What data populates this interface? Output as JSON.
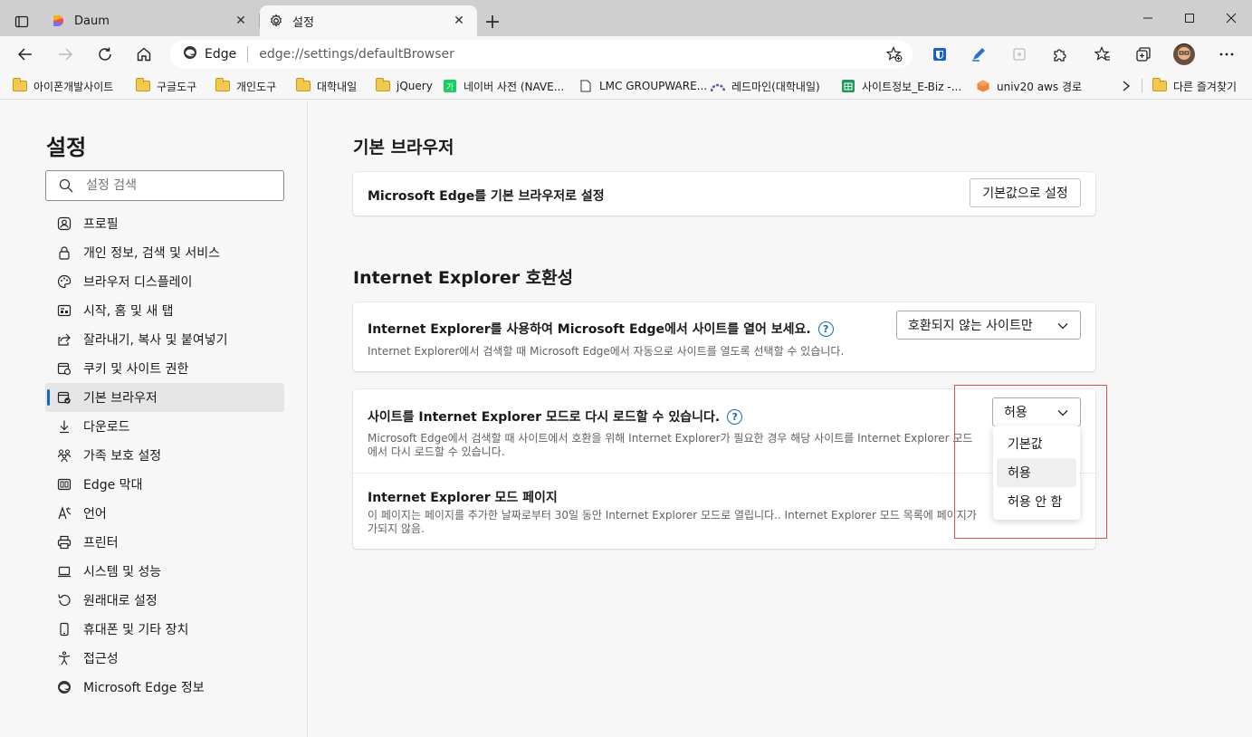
{
  "tabs": [
    {
      "title": "Daum",
      "icon": "daum-logo-icon"
    },
    {
      "title": "설정",
      "icon": "gear-icon"
    }
  ],
  "address": {
    "edge_label": "Edge",
    "url": "edge://settings/defaultBrowser"
  },
  "bookmarks": [
    {
      "label": "아이폰개발사이트",
      "icon": "folder-icon"
    },
    {
      "label": "구글도구",
      "icon": "folder-icon"
    },
    {
      "label": "개인도구",
      "icon": "folder-icon"
    },
    {
      "label": "대학내일",
      "icon": "folder-icon"
    },
    {
      "label": "jQuery",
      "icon": "folder-icon"
    },
    {
      "label": "네이버 사전 (NAVE...",
      "icon": "naver-dict-icon"
    },
    {
      "label": "LMC GROUPWARE...",
      "icon": "page-icon"
    },
    {
      "label": "레드마인(대학내일)",
      "icon": "redmine-icon"
    },
    {
      "label": "사이트정보_E-Biz -...",
      "icon": "sheets-icon"
    },
    {
      "label": "univ20 aws 경로",
      "icon": "aws-icon"
    }
  ],
  "other_favorites": "다른 즐겨찾기",
  "sidebar": {
    "title": "설정",
    "search_placeholder": "설정 검색",
    "items": [
      {
        "label": "프로필",
        "icon": "profile-icon"
      },
      {
        "label": "개인 정보, 검색 및 서비스",
        "icon": "lock-icon"
      },
      {
        "label": "브라우저 디스플레이",
        "icon": "palette-icon"
      },
      {
        "label": "시작, 홈 및 새 탭",
        "icon": "home-tab-icon"
      },
      {
        "label": "잘라내기, 복사 및 붙여넣기",
        "icon": "share-icon"
      },
      {
        "label": "쿠키 및 사이트 권한",
        "icon": "cookie-permissions-icon"
      },
      {
        "label": "기본 브라우저",
        "icon": "default-browser-icon",
        "active": true
      },
      {
        "label": "다운로드",
        "icon": "download-icon"
      },
      {
        "label": "가족 보호 설정",
        "icon": "family-icon"
      },
      {
        "label": "Edge 막대",
        "icon": "edge-bar-icon"
      },
      {
        "label": "언어",
        "icon": "language-icon"
      },
      {
        "label": "프린터",
        "icon": "printer-icon"
      },
      {
        "label": "시스템 및 성능",
        "icon": "laptop-icon"
      },
      {
        "label": "원래대로 설정",
        "icon": "reset-icon"
      },
      {
        "label": "휴대폰 및 기타 장치",
        "icon": "phone-icon"
      },
      {
        "label": "접근성",
        "icon": "accessibility-icon"
      },
      {
        "label": "Microsoft Edge 정보",
        "icon": "edge-logo-icon"
      }
    ]
  },
  "main": {
    "default_browser": {
      "heading": "기본 브라우저",
      "row_title": "Microsoft Edge를 기본 브라우저로 설정",
      "button": "기본값으로 설정"
    },
    "ie_compat": {
      "heading": "Internet Explorer 호환성",
      "open_sites": {
        "title": "Internet Explorer를 사용하여 Microsoft Edge에서 사이트를 열어 보세요.",
        "desc": "Internet Explorer에서 검색할 때 Microsoft Edge에서 자동으로 사이트를 열도록 선택할 수 있습니다.",
        "selected": "호환되지 않는 사이트만"
      },
      "reload": {
        "title": "사이트를 Internet Explorer 모드로 다시 로드할 수 있습니다.",
        "desc_line1": "Microsoft Edge에서 검색할 때 사이트에서 호환을 위해 Internet Explorer가 필요한 경우 해당 사이트를 Internet Explorer 모드",
        "desc_line2": "에서 다시 로드할 수 있습니다.",
        "selected": "허용",
        "options": [
          "기본값",
          "허용",
          "허용 안 함"
        ]
      },
      "ie_pages": {
        "title": "Internet Explorer 모드 페이지",
        "desc_line1": "이 페이지는 페이지를 추가한 날짜로부터 30일 동안 Internet Explorer 모드로 열립니다.. Internet Explorer 모드 목록에 페이지가",
        "desc_line2": "가되지 않음."
      }
    }
  },
  "colors": {
    "accent": "#0f6cbd",
    "highlight": "#d9534f"
  }
}
